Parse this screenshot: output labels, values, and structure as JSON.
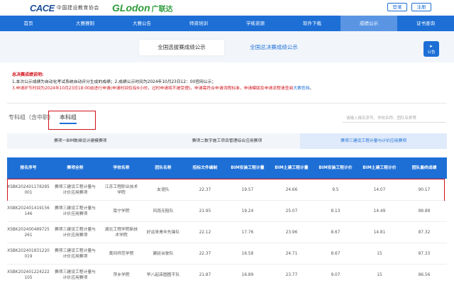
{
  "header": {
    "logo1_mark": "CACE",
    "logo1_text": "中国建设教育协会",
    "logo2_mark": "GLodon",
    "logo2_cn": "广联达",
    "login_label": "登录",
    "register_label": "注册"
  },
  "nav": {
    "items": [
      {
        "label": "首页"
      },
      {
        "label": "大赛赛制"
      },
      {
        "label": "大赛公告"
      },
      {
        "label": "师资培训"
      },
      {
        "label": "学练资源"
      },
      {
        "label": "软件下载"
      },
      {
        "label": "成绩公示"
      },
      {
        "label": "证书查询"
      }
    ],
    "active_index": 6
  },
  "toptabs": {
    "active_label": "全国选拔赛成绩公示",
    "inactive_label": "全国总决赛成绩公示"
  },
  "announce_button": {
    "label": "公告"
  },
  "notice": {
    "title": "总决赛成绩说明:",
    "line1": "1.本次公示成绩为自动化考试系统自动评分生成的成绩；2.成绩公示时间为2024年10月23日12：00官网公示；",
    "line2_a": "3.申请环节时间为2024年10月23日18:00前进行申请(申请时间仅有6小时，过时申请将不被受理)，申请需符合申请流程标准，申请模版及申请流程请查阅",
    "line2_link": "大赛官网",
    "line2_b": "。"
  },
  "group_tabs": {
    "tab1": "专科组（含中职）",
    "tab2": "本科组"
  },
  "search": {
    "placeholder": "请输入报名序号、学校名称、团队名称等"
  },
  "subtabs": [
    {
      "label": "赛项一BIM数维设计建模赛项"
    },
    {
      "label": "赛项二数字施工项目管理综合应用赛项"
    },
    {
      "label": "赛项三建设工程计量与计价应用赛项"
    }
  ],
  "table": {
    "headers": [
      "报名序号",
      "赛项全称",
      "学校名称",
      "团队名称",
      "招标文件编制",
      "BIM安装工程计量",
      "BIM土建工程计量",
      "BIM安装工程计价",
      "BIM土建工程计价",
      "团队最终成绩"
    ],
    "rows": [
      {
        "id": "XSBK202401178285001",
        "event": "赛项三建设工程计量与计价应用赛项",
        "school": "江苏工程职业技术学院",
        "team": "友谊队",
        "c1": "22.37",
        "c2": "19.57",
        "c3": "24.66",
        "c4": "9.5",
        "c5": "14.07",
        "total": "90.17"
      },
      {
        "id": "XSBK202401419156146",
        "event": "赛项三建设工程计量与计价应用赛项",
        "school": "南宁学院",
        "team": "风雨无阻队",
        "c1": "21.95",
        "c2": "19.24",
        "c3": "25.07",
        "c4": "8.13",
        "c5": "14.49",
        "total": "88.88"
      },
      {
        "id": "XSBK202400489725261",
        "event": "赛项三建设工程计量与计价应用赛项",
        "school": "湖北工程学院新技术学院",
        "team": "好运来青年先锋队",
        "c1": "22.12",
        "c2": "17.76",
        "c3": "23.96",
        "c4": "8.67",
        "c5": "14.81",
        "total": "87.32"
      },
      {
        "id": "XSBK202401831220019",
        "event": "赛项三建设工程计量与计价应用赛项",
        "school": "黄冈师范学院",
        "team": "翼廷台驶队",
        "c1": "22.37",
        "c2": "16.58",
        "c3": "24.71",
        "c4": "8.67",
        "c5": "15",
        "total": "87.33"
      },
      {
        "id": "XSBK202401224222105",
        "event": "赛项三建设工程计量与计价应用赛项",
        "school": "萍乡学院",
        "team": "早八起床圆图不队",
        "c1": "21.87",
        "c2": "16.89",
        "c3": "23.77",
        "c4": "9.07",
        "c5": "15",
        "total": "86.56"
      }
    ]
  }
}
